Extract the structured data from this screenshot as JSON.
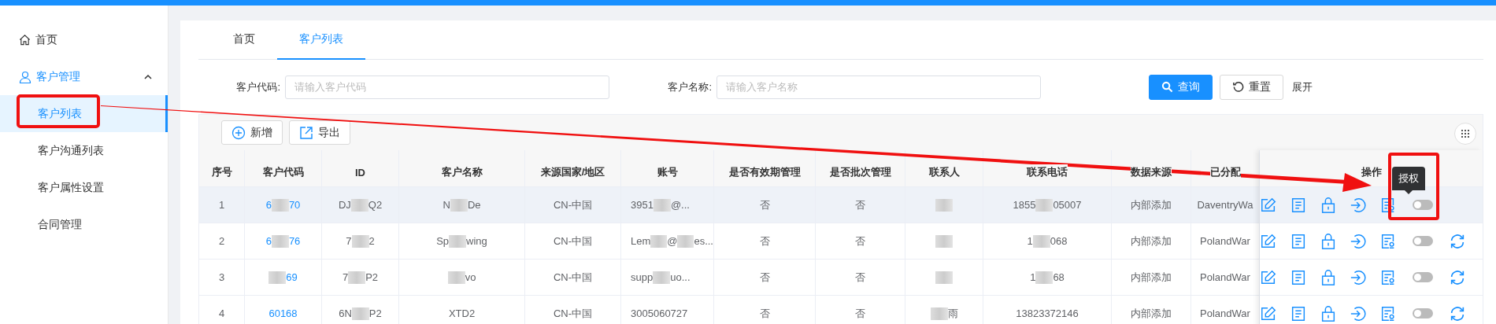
{
  "sidebar": {
    "items": [
      {
        "kind": "link",
        "label": "首页",
        "selected": false
      },
      {
        "kind": "group",
        "label": "客户管理",
        "expanded": true,
        "children": [
          {
            "label": "客户列表",
            "selected": true
          },
          {
            "label": "客户沟通列表",
            "selected": false
          },
          {
            "label": "客户属性设置",
            "selected": false
          },
          {
            "label": "合同管理",
            "selected": false
          }
        ]
      }
    ]
  },
  "tabs": [
    {
      "label": "首页",
      "selected": false
    },
    {
      "label": "客户列表",
      "selected": true
    }
  ],
  "search": {
    "fields": [
      {
        "label": "客户代码:",
        "placeholder": "请输入客户代码"
      },
      {
        "label": "客户名称:",
        "placeholder": "请输入客户名称"
      }
    ],
    "buttons": [
      {
        "kind": "primary",
        "label": "查询"
      },
      {
        "kind": "default",
        "label": "重置"
      }
    ],
    "expand_link": "展开"
  },
  "toolbar": [
    {
      "kind": "add",
      "label": "新增"
    },
    {
      "kind": "export",
      "label": "导出"
    }
  ],
  "table": {
    "columns": [
      {
        "label": "序号"
      },
      {
        "label": "客户代码",
        "kind": "link"
      },
      {
        "label": "ID"
      },
      {
        "label": "客户名称"
      },
      {
        "label": "来源国家/地区"
      },
      {
        "label": "账号"
      },
      {
        "label": "是否有效期管理"
      },
      {
        "label": "是否批次管理"
      },
      {
        "label": "联系人"
      },
      {
        "label": "联系电话"
      },
      {
        "label": "数据来源"
      },
      {
        "label": "已分配"
      }
    ],
    "action_column": "操作",
    "rows": [
      {
        "highlighted": true,
        "cells": [
          "1",
          [
            {
              "kind": "text",
              "text": "6"
            },
            {
              "kind": "blur"
            },
            {
              "kind": "text",
              "text": "70"
            }
          ],
          [
            {
              "kind": "text",
              "text": "DJ"
            },
            {
              "kind": "blur"
            },
            {
              "kind": "text",
              "text": "Q2"
            }
          ],
          [
            {
              "kind": "text",
              "text": "N"
            },
            {
              "kind": "blur"
            },
            {
              "kind": "text",
              "text": "De"
            }
          ],
          "CN-中国",
          [
            {
              "kind": "text",
              "text": "3951"
            },
            {
              "kind": "blur"
            },
            {
              "kind": "text",
              "text": "@..."
            }
          ],
          "否",
          "否",
          [
            {
              "kind": "blur"
            }
          ],
          [
            {
              "kind": "text",
              "text": "1855"
            },
            {
              "kind": "blur"
            },
            {
              "kind": "text",
              "text": "05007"
            }
          ],
          "内部添加",
          "DaventryWa"
        ],
        "actions": [
          {
            "kind": "edit"
          },
          {
            "kind": "detail"
          },
          {
            "kind": "lock"
          },
          {
            "kind": "login"
          },
          {
            "kind": "authorize"
          },
          {
            "kind": "toggle",
            "on": false
          }
        ]
      },
      {
        "highlighted": false,
        "cells": [
          "2",
          [
            {
              "kind": "text",
              "text": "6"
            },
            {
              "kind": "blur"
            },
            {
              "kind": "text",
              "text": "76"
            }
          ],
          [
            {
              "kind": "text",
              "text": "7"
            },
            {
              "kind": "blur"
            },
            {
              "kind": "text",
              "text": "2"
            }
          ],
          [
            {
              "kind": "text",
              "text": "Sp"
            },
            {
              "kind": "blur"
            },
            {
              "kind": "text",
              "text": "wing"
            }
          ],
          "CN-中国",
          [
            {
              "kind": "text",
              "text": "Lem"
            },
            {
              "kind": "blur"
            },
            {
              "kind": "text",
              "text": "@"
            },
            {
              "kind": "blur"
            },
            {
              "kind": "text",
              "text": "es..."
            }
          ],
          "否",
          "否",
          [
            {
              "kind": "blur"
            }
          ],
          [
            {
              "kind": "text",
              "text": "1"
            },
            {
              "kind": "blur"
            },
            {
              "kind": "text",
              "text": "068"
            }
          ],
          "内部添加",
          "PolandWar"
        ],
        "actions": [
          {
            "kind": "edit"
          },
          {
            "kind": "detail"
          },
          {
            "kind": "lock"
          },
          {
            "kind": "login"
          },
          {
            "kind": "authorize"
          },
          {
            "kind": "toggle",
            "on": false
          },
          {
            "kind": "refresh"
          }
        ]
      },
      {
        "highlighted": false,
        "cells": [
          "3",
          [
            {
              "kind": "blur"
            },
            {
              "kind": "text",
              "text": "69"
            }
          ],
          [
            {
              "kind": "text",
              "text": "7"
            },
            {
              "kind": "blur"
            },
            {
              "kind": "text",
              "text": "P2"
            }
          ],
          [
            {
              "kind": "blur"
            },
            {
              "kind": "text",
              "text": "vo"
            }
          ],
          "CN-中国",
          [
            {
              "kind": "text",
              "text": "supp"
            },
            {
              "kind": "blur"
            },
            {
              "kind": "text",
              "text": "uo..."
            }
          ],
          "否",
          "否",
          [
            {
              "kind": "blur"
            }
          ],
          [
            {
              "kind": "text",
              "text": "1"
            },
            {
              "kind": "blur"
            },
            {
              "kind": "text",
              "text": "68"
            }
          ],
          "内部添加",
          "PolandWar"
        ],
        "actions": [
          {
            "kind": "edit"
          },
          {
            "kind": "detail"
          },
          {
            "kind": "lock"
          },
          {
            "kind": "login"
          },
          {
            "kind": "authorize"
          },
          {
            "kind": "toggle",
            "on": false
          },
          {
            "kind": "refresh"
          }
        ]
      },
      {
        "highlighted": false,
        "cells": [
          "4",
          "60168",
          [
            {
              "kind": "text",
              "text": "6N"
            },
            {
              "kind": "blur"
            },
            {
              "kind": "text",
              "text": "P2"
            }
          ],
          "XTD2",
          "CN-中国",
          "3005060727",
          "否",
          "否",
          [
            {
              "kind": "blur"
            },
            {
              "kind": "text",
              "text": "雨"
            }
          ],
          "13823372146",
          "内部添加",
          "PolandWar"
        ],
        "actions": [
          {
            "kind": "edit"
          },
          {
            "kind": "detail"
          },
          {
            "kind": "lock"
          },
          {
            "kind": "login"
          },
          {
            "kind": "authorize"
          },
          {
            "kind": "toggle",
            "on": false
          },
          {
            "kind": "refresh"
          }
        ]
      }
    ]
  },
  "tooltip": {
    "text": "授权"
  }
}
